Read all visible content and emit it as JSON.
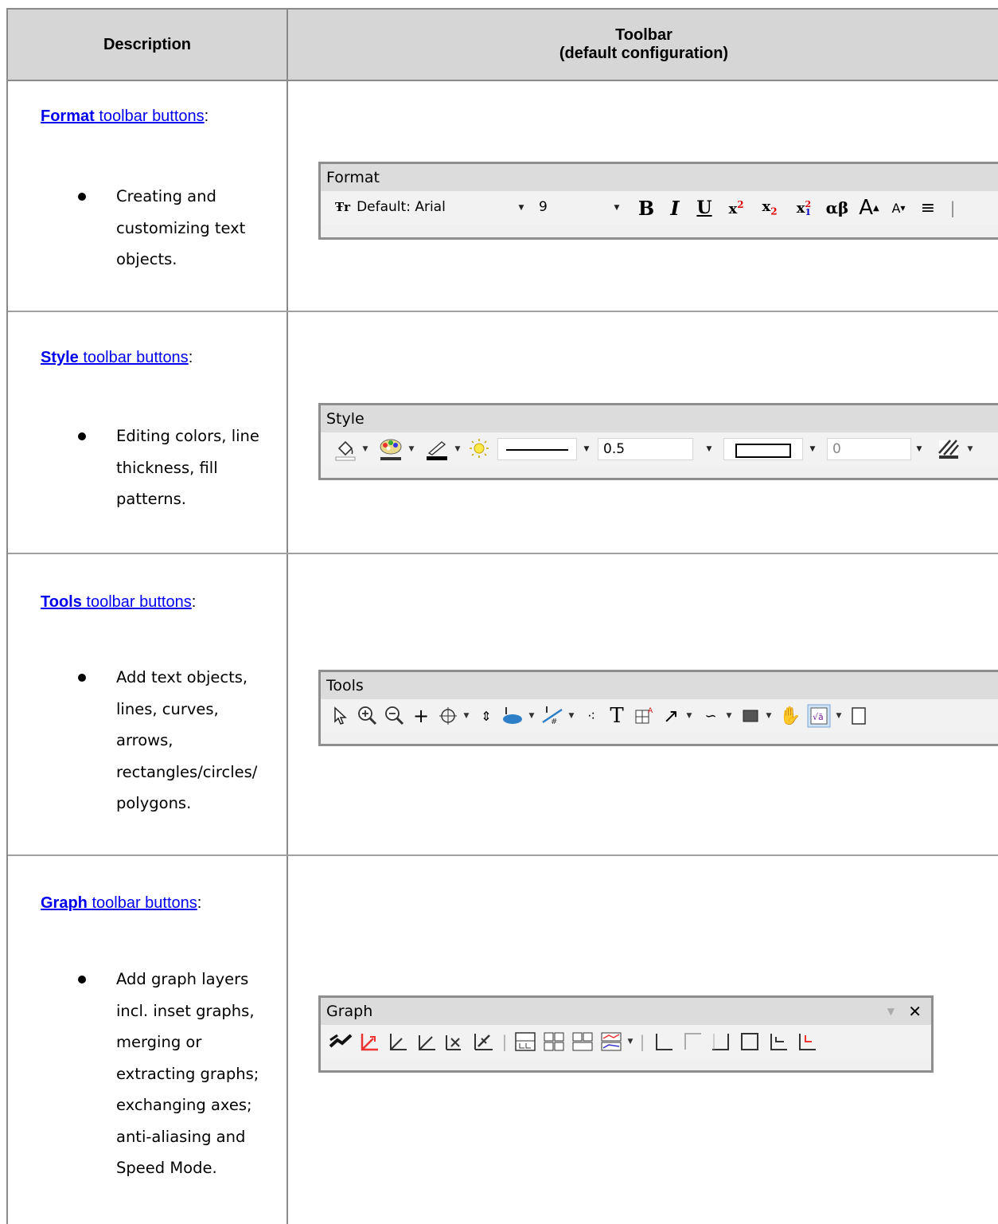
{
  "table": {
    "col1_header": "Description",
    "col2_header_line1": "Toolbar",
    "col2_header_line2": "(default configuration)"
  },
  "rows": [
    {
      "title_bold": "Format",
      "title_rest": " toolbar buttons",
      "title_suffix": ":",
      "bullet_lines": [
        "Creating and",
        "customizing text",
        "objects."
      ],
      "toolbar": {
        "title": "Format",
        "font_value": "Default: Arial",
        "size_value": "9",
        "buttons": [
          "B",
          "I",
          "U",
          "x²",
          "x₂",
          "x₁²",
          "αβ",
          "A",
          "A",
          "≡"
        ]
      }
    },
    {
      "title_bold": "Style",
      "title_rest": " toolbar buttons",
      "title_suffix": ":",
      "bullet_lines": [
        "Editing colors, line",
        "thickness, fill",
        "patterns."
      ],
      "toolbar": {
        "title": "Style",
        "line_width_value": "0.5",
        "pattern_width_value": "0"
      }
    },
    {
      "title_bold": "Tools",
      "title_rest": " toolbar buttons",
      "title_suffix": ":",
      "bullet_lines": [
        "Add text objects,",
        "lines, curves,",
        "arrows,",
        "rectangles/circles/",
        "polygons."
      ],
      "toolbar": {
        "title": "Tools",
        "text_tool": "T"
      }
    },
    {
      "title_bold": "Graph",
      "title_rest": " toolbar buttons",
      "title_suffix": ":",
      "bullet_lines": [
        "Add graph layers",
        "incl. inset graphs,",
        "merging or",
        "extracting graphs;",
        "exchanging axes;",
        "anti-aliasing and",
        "Speed Mode."
      ],
      "toolbar": {
        "title": "Graph",
        "close_glyph": "✕"
      }
    }
  ],
  "colors": {
    "header_bg": "#d6d6d6",
    "link": "#0000ee",
    "border": "#8a8a8a"
  }
}
